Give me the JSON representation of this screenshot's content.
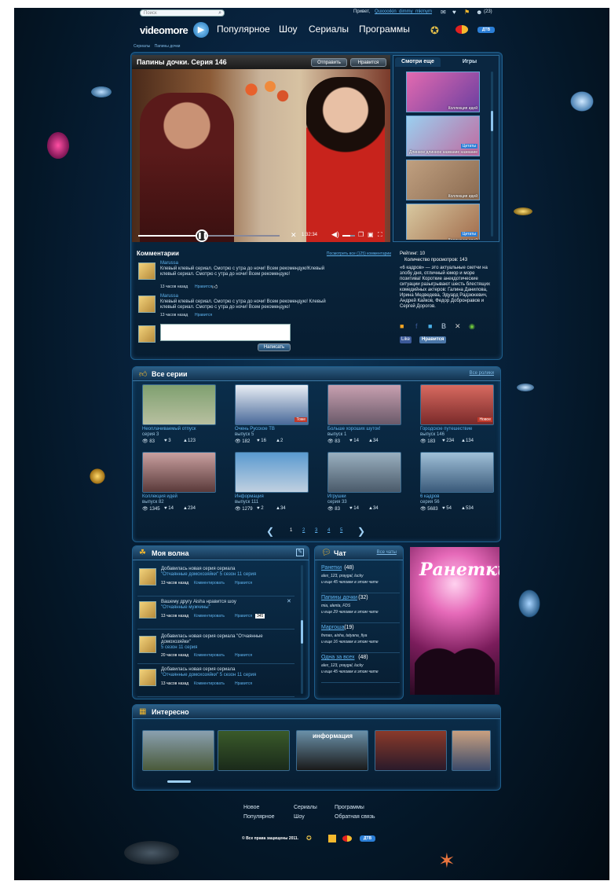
{
  "header": {
    "search_placeholder": "Поиск",
    "greeting": "Привет,",
    "username": "Quxxxxkin_dimmy_mkmym",
    "friends_count": "(23)",
    "logo_text": "videomore",
    "nav": [
      "Популярное",
      "Шоу",
      "Сериалы",
      "Программы"
    ],
    "partner_badge": "ДТВ"
  },
  "breadcrumb": [
    "Сериалы",
    "Папины дочки"
  ],
  "player": {
    "title": "Папины дочки. Серия 146",
    "send_label": "Отправить",
    "like_label": "Нравится",
    "time": "1:32:34",
    "progress": 0.45,
    "volume": 0.6
  },
  "side_tabs": {
    "tab1": "Смотри еще",
    "tab2": "Игры",
    "items": [
      {
        "caption": "Коллекция идей",
        "badge": ""
      },
      {
        "caption": "Длинное длинное название название",
        "badge": "Цитаты"
      },
      {
        "caption": "Коллекция идей",
        "badge": ""
      },
      {
        "caption": "Коллекция идей",
        "badge": "Цитаты"
      }
    ]
  },
  "comments": {
    "title": "Комментарии",
    "view_all": "Посмотреть все (125) комментарии",
    "items": [
      {
        "author": "Marussa",
        "text": "Клевый клевый сериал. Смотрю с утра до ночи! Всем рекомендую!Клевый клевый сериал. Смотрю с утра до ночи! Всем рекомендую!",
        "time": "13 часов назад",
        "like": "Нравится"
      },
      {
        "author": "Marussa",
        "text": "Клевый клевый сериал. Смотрю с утра до ночи! Всем рекомендую! Клевый клевый сериал. Смотрю с утра до ночи! Всем рекомендую!",
        "time": "13 часов назад",
        "like": "Нравится"
      }
    ],
    "submit_label": "Написать"
  },
  "info": {
    "rating": "Рейтинг: 10",
    "views": "Количество просмотров: 143",
    "description": "«6 кадров» — это актуальные скетчи на злобу дня, отличный юмор и море позитива! Короткие анекдотические ситуации разыгрывают шесть блестящих комедийных актеров: Галина Данилова, Ирина Медведева, Эдуард Радзюкевич, Андрей Кайков, Федор Добронравов и Сергей Дорогов.",
    "like_label": "Like",
    "vk_label": "Нравится"
  },
  "all_series": {
    "title": "Все серии",
    "all_link": "Все ролики",
    "items": [
      {
        "title": "Неоплачиваемый отпуск",
        "sub": "серия 3",
        "views": "83",
        "likes": "3",
        "comments": "123",
        "badge": ""
      },
      {
        "title": "Очень Русское ТВ",
        "sub": "выпуск 5",
        "views": "182",
        "likes": "16",
        "comments": "2",
        "badge": "Тоже"
      },
      {
        "title": "Больше хороших шуток!",
        "sub": "выпуск 1",
        "views": "83",
        "likes": "14",
        "comments": "34",
        "badge": ""
      },
      {
        "title": "Городское путешествие",
        "sub": "выпуск 146",
        "views": "183",
        "likes": "234",
        "comments": "134",
        "badge": "Новое"
      },
      {
        "title": "Коллекция идей",
        "sub": "выпуск 82",
        "views": "1345",
        "likes": "14",
        "comments": "234",
        "badge": ""
      },
      {
        "title": "Информация",
        "sub": "выпуск 111",
        "views": "1279",
        "likes": "2",
        "comments": "34",
        "badge": ""
      },
      {
        "title": "Игрушки",
        "sub": "серия 33",
        "views": "83",
        "likes": "14",
        "comments": "34",
        "badge": ""
      },
      {
        "title": "6 кадров",
        "sub": "серия 56",
        "views": "5683",
        "likes": "54",
        "comments": "534",
        "badge": ""
      }
    ],
    "pages": [
      "1",
      "2",
      "3",
      "4",
      "5"
    ]
  },
  "wave": {
    "title": "Моя волна",
    "items": [
      {
        "text": "Добавилась новая серия сериала",
        "link": "\"Отчаянные домохозяйки\" 5 сезон 11 серия",
        "time": "13 часов назад",
        "action": "Комментировать",
        "like": "Нравится"
      },
      {
        "text": "Вашему другу Aisha нравится шоу",
        "link": "\"Отчаянные мужчины\"",
        "time": "13 часов назад",
        "action": "Комментировать",
        "like": "Нравится"
      },
      {
        "text": "Добавилась новая серия сериала \"Отчаянные домохозяйки\"",
        "link": "5 сезон 11 серия",
        "time": "20 часов назад",
        "action": "Комментировать",
        "like": "Нравится"
      },
      {
        "text": "Добавилась новая серия сериала",
        "link": "\"Отчаянные домохозяйки\" 5 сезон 11 серия",
        "time": "13 часов назад",
        "action": "Комментировать",
        "like": "Нравится"
      }
    ],
    "count_badge": "345"
  },
  "chat": {
    "title": "Чат",
    "all_link": "Все чаты",
    "rooms": [
      {
        "name": "Ранетки",
        "count": "(48)",
        "users": "alex_123, praygal, lucky",
        "more": "и еще 45 человек в этом чате"
      },
      {
        "name": "Папины дочки",
        "count": "(32)",
        "users": "mia, alenta, FDS",
        "more": "и еще 29 человек в этом чате"
      },
      {
        "name": "Маргоша",
        "count": "(19)",
        "users": "frenas, aisha, tatyana_fiya",
        "more": "и еще 16 человек в этом чате"
      },
      {
        "name": "Одна за всех",
        "count": "(48)",
        "users": "alex_123, praygal, lucky",
        "more": "и еще 45 человек в этом чате"
      }
    ]
  },
  "promo": {
    "title": "Ранетки"
  },
  "interesting": {
    "title": "Интересно",
    "banner_text": "информация"
  },
  "footer": {
    "links": [
      "Новое",
      "Сериалы",
      "Программы",
      "Популярное",
      "Шоу",
      "Обратная связь"
    ],
    "copyright": "© Все права защищены 2011."
  },
  "colors": {
    "accent": "#5fb3ee",
    "bg": "#082440",
    "panel_border": "#1e5e8c"
  }
}
